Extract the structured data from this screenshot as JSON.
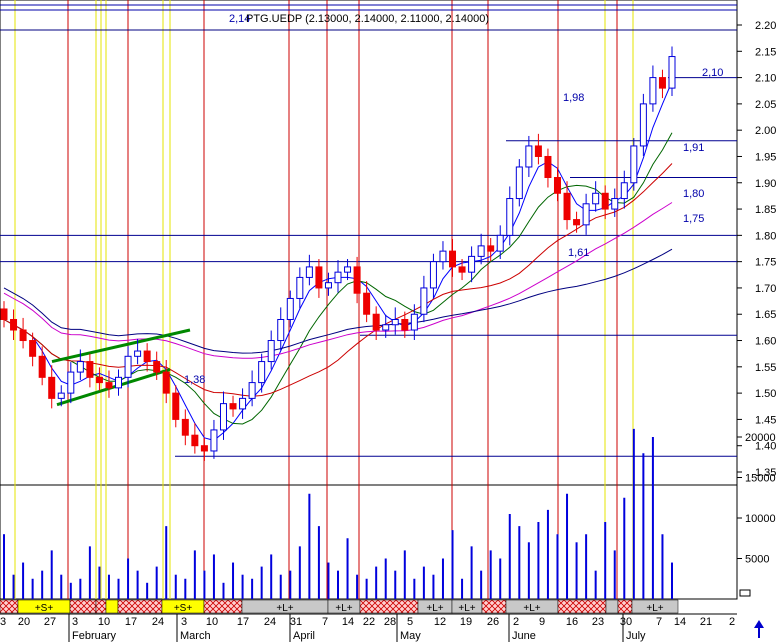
{
  "chart_data": {
    "type": "candlestick",
    "header_label": "2,14",
    "title": "PTG.UEDP (2.13000, 2.14000, 2.11000, 2.14000)",
    "price_axis": {
      "min": 1.3,
      "max": 2.22,
      "ticks": [
        "2.20",
        "2.15",
        "2.10",
        "2.05",
        "2.00",
        "1.95",
        "1.90",
        "1.85",
        "1.80",
        "1.75",
        "1.70",
        "1.65",
        "1.60",
        "1.55",
        "1.50",
        "1.45",
        "1.40",
        "1.35"
      ]
    },
    "volume_axis": {
      "min": 0,
      "max": 27000,
      "ticks": [
        "20000",
        "15000",
        "10000",
        "5000"
      ]
    },
    "x_ticks": [
      "3",
      "20",
      "27",
      "3",
      "10",
      "17",
      "24",
      "3",
      "10",
      "17",
      "24",
      "31",
      "7",
      "14",
      "22",
      "28",
      "5",
      "12",
      "19",
      "26",
      "2",
      "9",
      "16",
      "23",
      "30",
      "7",
      "14",
      "21",
      "2"
    ],
    "month_labels": [
      "February",
      "March",
      "April",
      "May",
      "June",
      "July"
    ],
    "signal_labels": [
      "+S+",
      "+S+",
      "+L+",
      "+L+",
      "+L+",
      "+L+",
      "+L+",
      "+L+"
    ],
    "price_levels": [
      {
        "label": "2,10",
        "value": 2.1
      },
      {
        "label": "1,98",
        "value": 1.98
      },
      {
        "label": "1,91",
        "value": 1.91
      },
      {
        "label": "1,80",
        "value": 1.8
      },
      {
        "label": "1,75",
        "value": 1.75
      },
      {
        "label": "1,61",
        "value": 1.61
      },
      {
        "label": "1,38",
        "value": 1.38
      }
    ],
    "ohlc_close_estimates": [
      1.64,
      1.62,
      1.6,
      1.57,
      1.53,
      1.49,
      1.5,
      1.54,
      1.56,
      1.53,
      1.52,
      1.51,
      1.53,
      1.57,
      1.58,
      1.56,
      1.54,
      1.5,
      1.45,
      1.42,
      1.4,
      1.39,
      1.43,
      1.48,
      1.47,
      1.49,
      1.52,
      1.56,
      1.6,
      1.64,
      1.68,
      1.72,
      1.74,
      1.7,
      1.71,
      1.73,
      1.74,
      1.69,
      1.65,
      1.62,
      1.63,
      1.64,
      1.62,
      1.65,
      1.7,
      1.75,
      1.77,
      1.74,
      1.73,
      1.76,
      1.78,
      1.77,
      1.8,
      1.87,
      1.93,
      1.97,
      1.95,
      1.91,
      1.88,
      1.83,
      1.82,
      1.86,
      1.88,
      1.85,
      1.87,
      1.9,
      1.97,
      2.05,
      2.1,
      2.08,
      2.14
    ],
    "volume_estimates": [
      8000,
      3000,
      4500,
      2500,
      3500,
      6000,
      3000,
      2000,
      2500,
      6500,
      4000,
      3000,
      2500,
      5000,
      3500,
      2000,
      4000,
      9000,
      3000,
      2500,
      6000,
      3500,
      5500,
      2000,
      4500,
      3000,
      2500,
      4000,
      5500,
      3000,
      3500,
      6500,
      13000,
      9000,
      4500,
      3500,
      7500,
      3000,
      2500,
      4000,
      5000,
      3500,
      6000,
      2500,
      4000,
      3000,
      5000,
      8500,
      2500,
      6500,
      3500,
      6000,
      5000,
      10500,
      9000,
      7000,
      9500,
      11000,
      8000,
      13000,
      7000,
      8000,
      3500,
      9500,
      6000,
      12500,
      21000,
      18000,
      20000,
      8000,
      4500
    ],
    "legend": "none",
    "grid": "vertical event lines"
  }
}
